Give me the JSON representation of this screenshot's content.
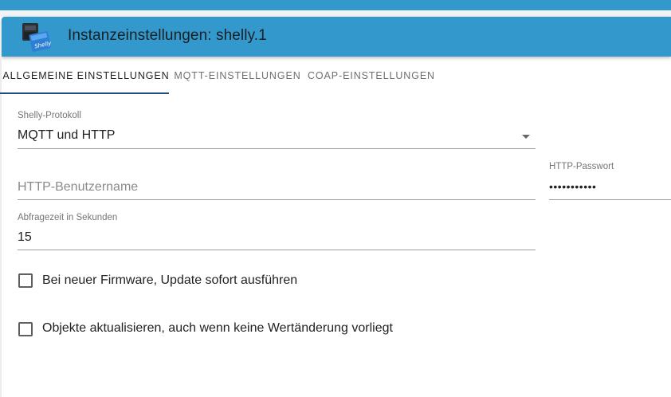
{
  "header": {
    "title": "Instanzeinstellungen: shelly.1",
    "logo_icon": "shelly-logo-icon",
    "accent_color": "#3399cc"
  },
  "tabs": [
    {
      "label": "ALLGEMEINE EINSTELLUNGEN",
      "active": true
    },
    {
      "label": "MQTT-EINSTELLUNGEN",
      "active": false
    },
    {
      "label": "COAP-EINSTELLUNGEN",
      "active": false
    }
  ],
  "form": {
    "protocol": {
      "label": "Shelly-Protokoll",
      "value": "MQTT und HTTP"
    },
    "http_user": {
      "placeholder": "HTTP-Benutzername",
      "value": ""
    },
    "http_password": {
      "label": "HTTP-Passwort",
      "value": "•••••••••••"
    },
    "poll_interval": {
      "label": "Abfragezeit in Sekunden",
      "value": "15"
    },
    "firmware_update": {
      "label": "Bei neuer Firmware, Update sofort ausführen",
      "checked": false
    },
    "update_objects": {
      "label": "Objekte aktualisieren, auch wenn keine Wertänderung vorliegt",
      "checked": false
    }
  }
}
